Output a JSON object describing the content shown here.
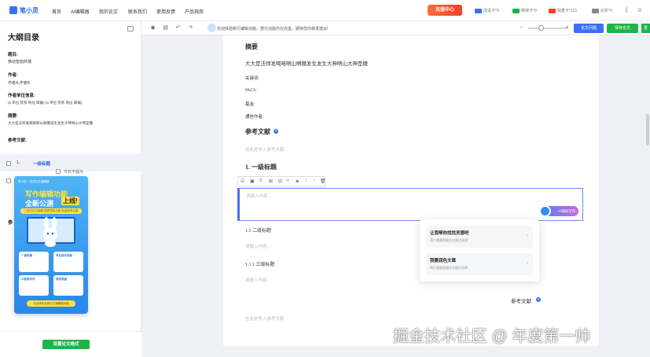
{
  "topnav": {
    "logo": "笔小灵",
    "items": [
      "首页",
      "AI编辑器",
      "我的论文",
      "联系我们",
      "使用反馈",
      "产品指南"
    ],
    "vip": "充值中心",
    "cards": [
      {
        "label": "改进卡*0",
        "color": "#3b6ff5"
      },
      {
        "label": "畅得卡*0",
        "color": "#1fb34a"
      },
      {
        "label": "除重卡*121",
        "color": "#f0412a"
      },
      {
        "label": "必析*0",
        "color": "#888888"
      }
    ]
  },
  "sidebar": {
    "title": "大纲目录",
    "topic_label": "题目:",
    "topic_value": "移动智能终端",
    "author_label": "作者:",
    "author_value": "作者A,作者B",
    "unit_label": "作者单位信息:",
    "unit_value": "(a 单位 院系 地址 邮编) (a 单位 院系 地址 邮编)",
    "abstract_label": "摘要:",
    "abstract_value": "大大是法师发喝咯啊山啊撒发生发生大神啊山大神是撒",
    "refs_label": "参考文献:",
    "outline_num": "1.",
    "outline_item": "一级标题",
    "hide_today": "今日不提示",
    "ref_truncated": "参",
    "format_button": "设置论文格式"
  },
  "promo": {
    "header": "笔小灵 一站式论文编辑器",
    "line1": "写作编辑功能",
    "line2": "全新公测",
    "badge": "上线!",
    "sub": "一站式论文编辑·图表排版功能·免费参考文献",
    "cards": [
      "一键改稿",
      "专业格式排版",
      "AI智能写作",
      "润色降重"
    ],
    "cta": "点击体验全新论文编辑器功能"
  },
  "toolbar": {
    "notice": "欢迎体验新行编辑功能，部分功能仍在完善，期待您向我发建议!",
    "check_button": "论文问题",
    "save_button": "保存论文",
    "more_button": "更"
  },
  "paper": {
    "abstract_heading": "摘要",
    "abstract_text": "大大是法师发喝咯啊山啊撒发生发生大神啊山大神是撒",
    "keywords": "关键词:",
    "pacs": "PACS:",
    "fund": "基金:",
    "correspondence": "通信作者:",
    "refs_heading": "参考文献",
    "refs_placeholder": "在此处导入参考文献",
    "h1": "1. 一级标题",
    "input_placeholder": "请输入内容...",
    "ai_button": "AI辅助写作",
    "h2": "1.1 二级标题",
    "placeholder2": "请输入内容...",
    "h3": "1.1.1 三级标题",
    "placeholder3": "请输入内容...",
    "refs_heading2": "参考文献",
    "refs_placeholder2": "在此处导入参考文献"
  },
  "suggest": {
    "item1_title": "让我帮你找找灵感吧",
    "item1_desc": "简介需要根据论文题目选择",
    "item2_title": "我要润色文章",
    "item2_desc": "简介需要根据论文题目选择"
  },
  "watermark": "掘金技术社区 @ 年度第一帅"
}
